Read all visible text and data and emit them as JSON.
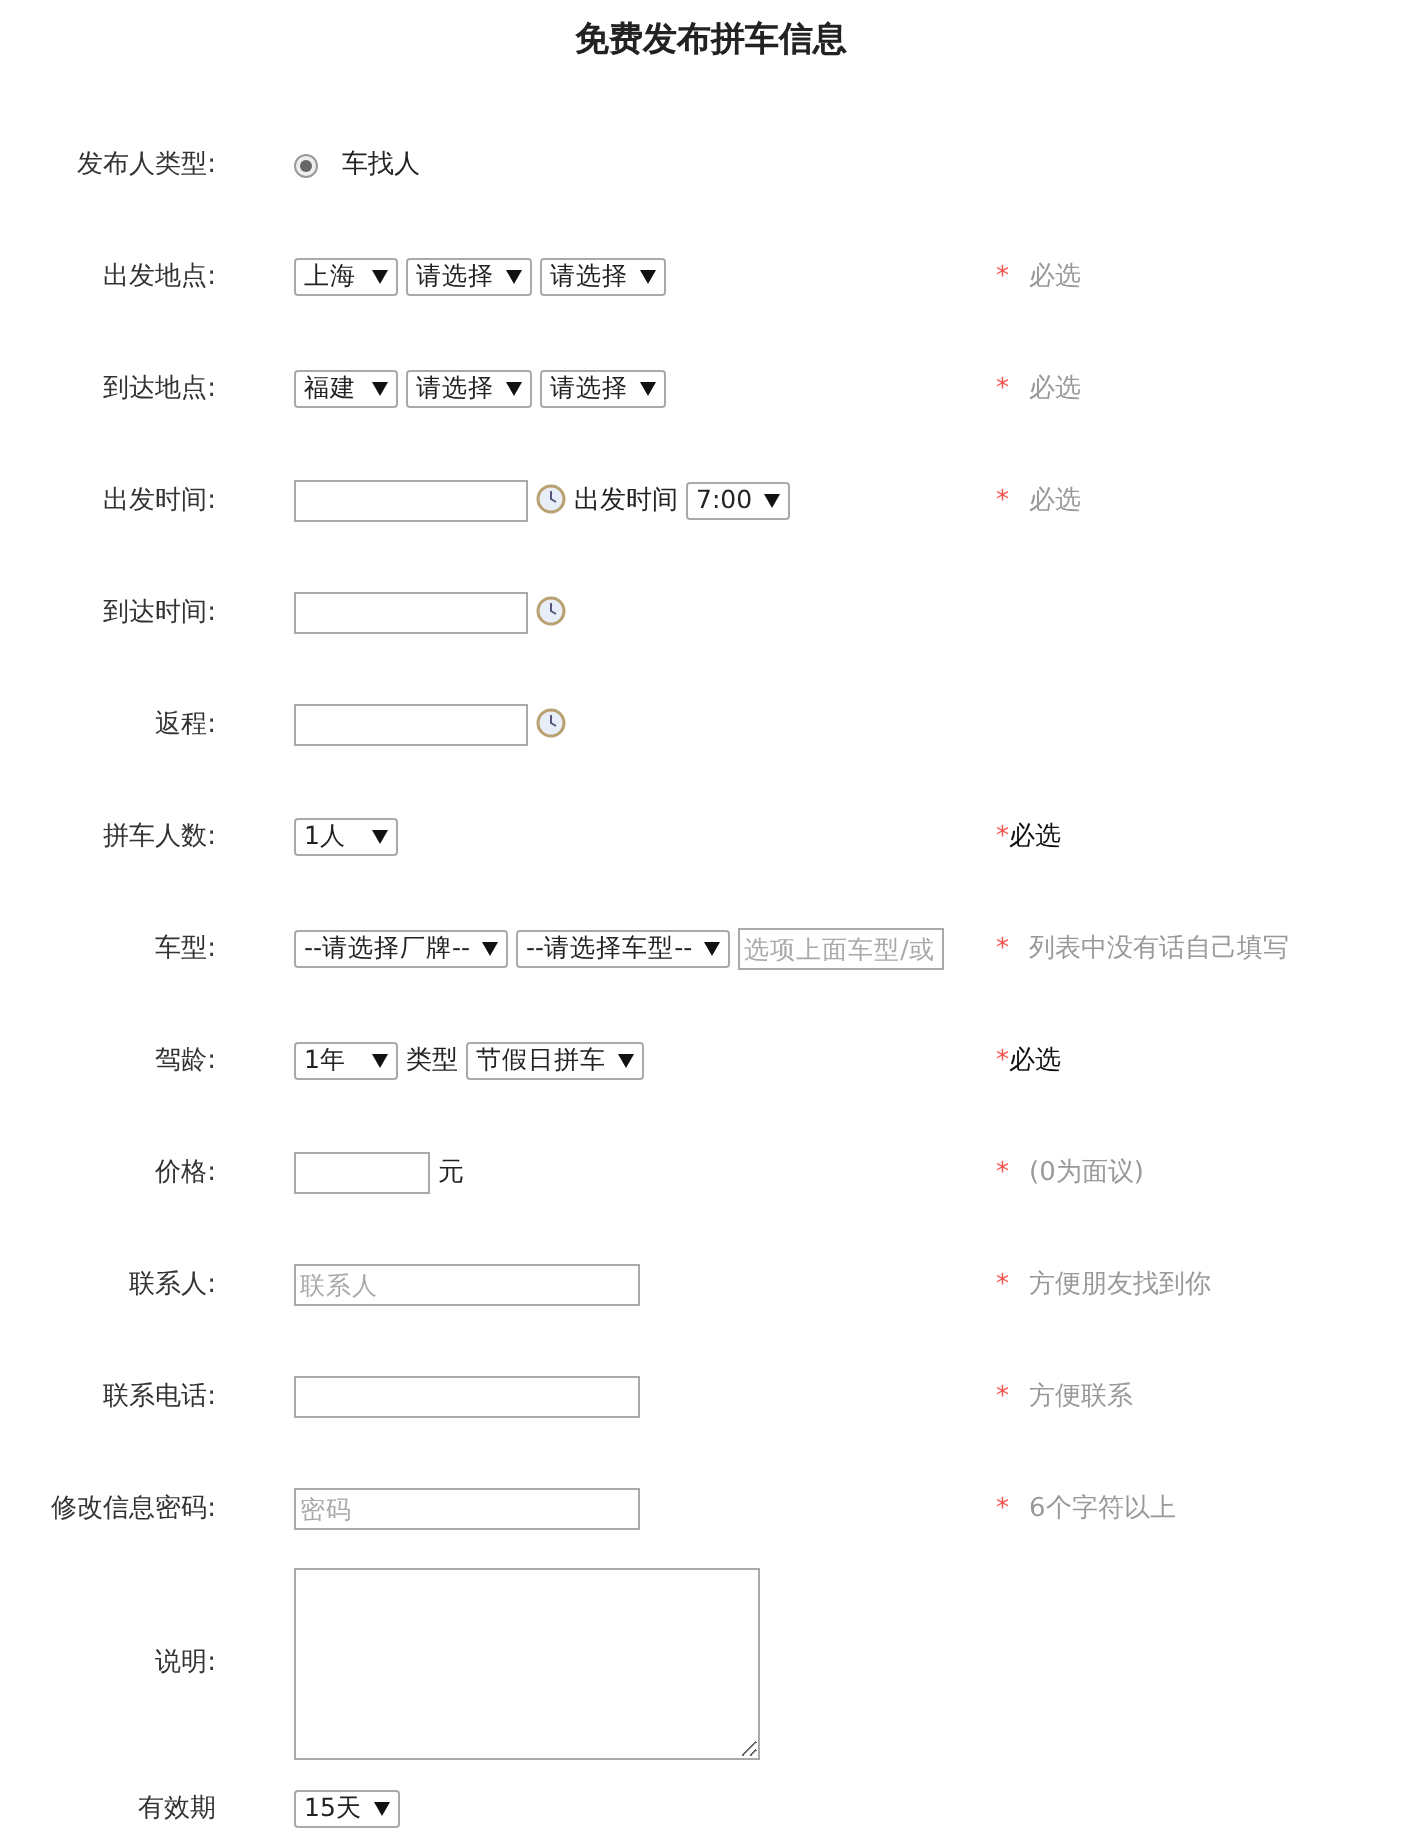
{
  "title": "免费发布拼车信息",
  "rows": [
    {
      "label": "发布人类型:",
      "items": [
        {
          "kind": "radio",
          "text": "车找人",
          "selected": true
        }
      ]
    },
    {
      "label": "出发地点:",
      "items": [
        {
          "kind": "select",
          "text": "上海"
        },
        {
          "kind": "select",
          "text": "请选择"
        },
        {
          "kind": "select",
          "text": "请选择"
        }
      ],
      "note": {
        "kind": "hint",
        "star": "*",
        "text": "必选"
      }
    },
    {
      "label": "到达地点:",
      "items": [
        {
          "kind": "select",
          "text": "福建"
        },
        {
          "kind": "select",
          "text": "请选择"
        },
        {
          "kind": "select",
          "text": "请选择"
        }
      ],
      "note": {
        "kind": "hint",
        "star": "*",
        "text": "必选"
      }
    },
    {
      "label": "出发时间:",
      "items": [
        {
          "kind": "date"
        },
        {
          "kind": "clock"
        },
        {
          "kind": "text",
          "text": "出发时间"
        },
        {
          "kind": "select",
          "text": "7:00"
        }
      ],
      "note": {
        "kind": "hint",
        "star": "*",
        "text": "必选"
      }
    },
    {
      "label": "到达时间:",
      "items": [
        {
          "kind": "date"
        },
        {
          "kind": "clock"
        }
      ]
    },
    {
      "label": "返程:",
      "items": [
        {
          "kind": "date"
        },
        {
          "kind": "clock"
        }
      ]
    },
    {
      "label": "拼车人数:",
      "items": [
        {
          "kind": "select",
          "text": "1人"
        }
      ],
      "note": {
        "kind": "plain",
        "star": "*",
        "text": "必选"
      }
    },
    {
      "label": "车型:",
      "items": [
        {
          "kind": "select",
          "text": "--请选择厂牌--"
        },
        {
          "kind": "select",
          "text": "--请选择车型--"
        },
        {
          "kind": "short",
          "placeholder": "选项上面车型/或"
        }
      ],
      "note": {
        "kind": "hint",
        "star": "*",
        "text": "列表中没有话自己填写"
      }
    },
    {
      "label": "驾龄:",
      "items": [
        {
          "kind": "select",
          "text": "1年"
        },
        {
          "kind": "text",
          "text": "类型"
        },
        {
          "kind": "select",
          "text": "节假日拼车"
        }
      ],
      "note": {
        "kind": "plain",
        "star": "*",
        "text": "必选"
      }
    },
    {
      "label": "价格:",
      "items": [
        {
          "kind": "price"
        },
        {
          "kind": "text",
          "text": "元"
        }
      ],
      "note": {
        "kind": "hint",
        "star": "*",
        "text": "(0为面议)"
      }
    },
    {
      "label": "联系人:",
      "items": [
        {
          "kind": "wide",
          "placeholder": "联系人"
        }
      ],
      "note": {
        "kind": "hint",
        "star": "*",
        "text": "方便朋友找到你"
      }
    },
    {
      "label": "联系电话:",
      "items": [
        {
          "kind": "wide"
        }
      ],
      "note": {
        "kind": "hint",
        "star": "*",
        "text": "方便联系"
      }
    },
    {
      "label": "修改信息密码:",
      "items": [
        {
          "kind": "wide",
          "placeholder": "密码"
        }
      ],
      "note": {
        "kind": "hint",
        "star": "*",
        "text": "6个字符以上"
      }
    },
    {
      "label": "说明:",
      "items": [
        {
          "kind": "area"
        }
      ]
    },
    {
      "label": "有效期",
      "items": [
        {
          "kind": "select",
          "text": "15天"
        }
      ]
    }
  ]
}
